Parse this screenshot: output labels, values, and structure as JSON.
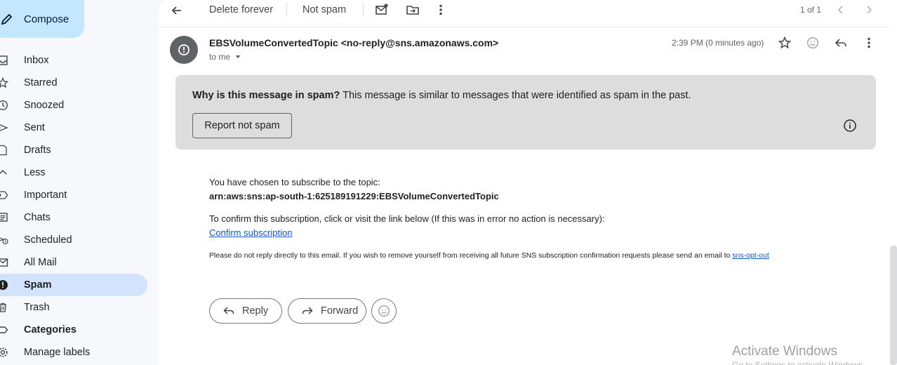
{
  "compose": {
    "label": "Compose"
  },
  "sidebar": {
    "items": [
      {
        "label": "Inbox",
        "icon": "inbox-icon"
      },
      {
        "label": "Starred",
        "icon": "star-icon"
      },
      {
        "label": "Snoozed",
        "icon": "clock-icon"
      },
      {
        "label": "Sent",
        "icon": "send-icon"
      },
      {
        "label": "Drafts",
        "icon": "draft-icon"
      },
      {
        "label": "Less",
        "icon": "chevron-up-icon"
      },
      {
        "label": "Important",
        "icon": "important-icon"
      },
      {
        "label": "Chats",
        "icon": "chat-icon"
      },
      {
        "label": "Scheduled",
        "icon": "scheduled-icon"
      },
      {
        "label": "All Mail",
        "icon": "all-mail-icon"
      },
      {
        "label": "Spam",
        "icon": "spam-icon",
        "active": true
      },
      {
        "label": "Trash",
        "icon": "trash-icon"
      },
      {
        "label": "Categories",
        "icon": "label-icon"
      },
      {
        "label": "Manage labels",
        "icon": "gear-icon"
      }
    ]
  },
  "toolbar": {
    "delete_forever": "Delete forever",
    "not_spam": "Not spam",
    "pager": "1 of 1"
  },
  "message": {
    "sender": "EBSVolumeConvertedTopic <no-reply@sns.amazonaws.com>",
    "to": "to me",
    "time": "2:39 PM (0 minutes ago)"
  },
  "spam_banner": {
    "why": "Why is this message in spam?",
    "reason": " This message is similar to messages that were identified as spam in the past.",
    "report_button": "Report not spam"
  },
  "body": {
    "line1": "You have chosen to subscribe to the topic:",
    "topic_arn": "arn:aws:sns:ap-south-1:625189191229:EBSVolumeConvertedTopic",
    "line3": "To confirm this subscription, click or visit the link below (If this was in error no action is necessary):",
    "confirm_link": "Confirm subscription",
    "footer_text": "Please do not reply directly to this email. If you wish to remove yourself from receiving all future SNS subscription confirmation requests please send an email to ",
    "optout_link": "sns-opt-out"
  },
  "actions": {
    "reply": "Reply",
    "forward": "Forward"
  },
  "watermark": {
    "title": "Activate Windows",
    "subtitle": "Go to Settings to activate Windows."
  }
}
